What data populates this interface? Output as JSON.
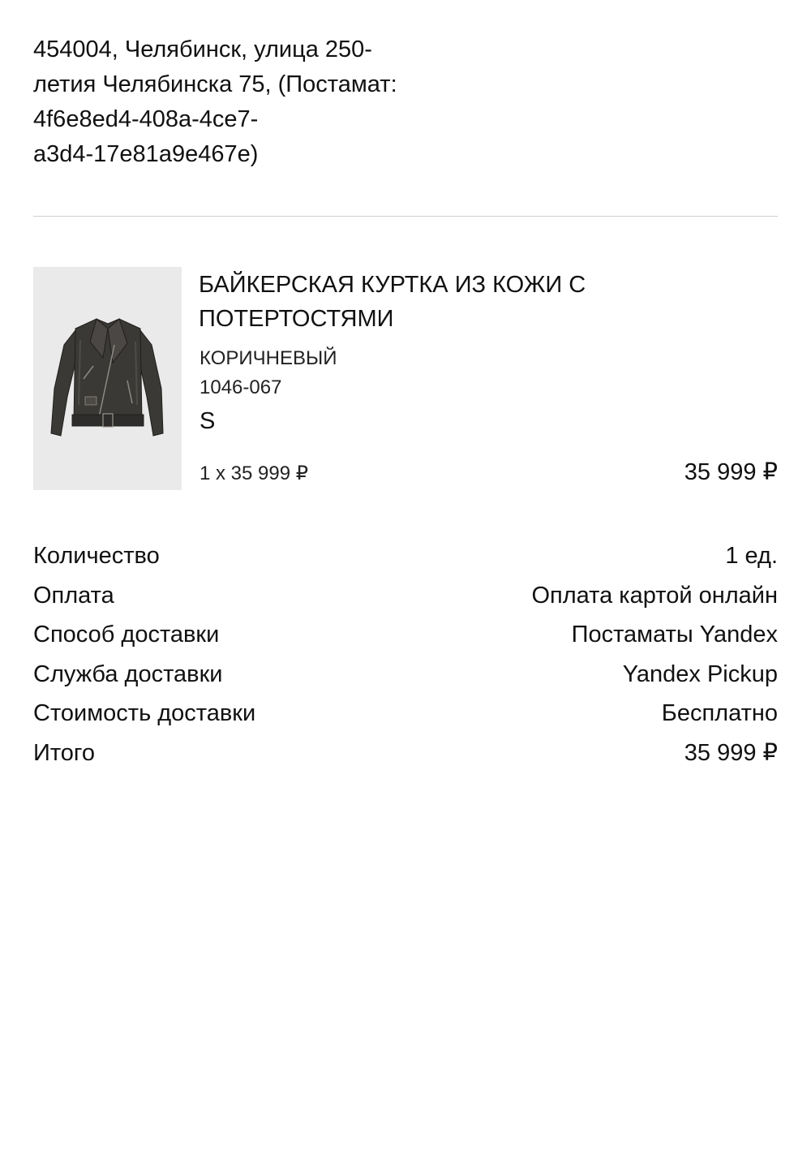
{
  "address": {
    "lines": [
      "454004, Челябинск, улица 250-",
      "летия Челябинска 75, (Постамат:",
      "4f6e8ed4-408a-4ce7-",
      "a3d4-17e81a9e467e)"
    ]
  },
  "product": {
    "image_icon": "leather-biker-jacket",
    "name_lines": [
      "БАЙКЕРСКАЯ КУРТКА ИЗ КОЖИ С",
      "ПОТЕРТОСТЯМИ"
    ],
    "color": "КОРИЧНЕВЫЙ",
    "code": "1046-067",
    "size": "S",
    "qty_price": "1 x 35 999 ₽",
    "total": "35 999 ₽"
  },
  "summary": {
    "rows": [
      {
        "label": "Количество",
        "value": "1 ед."
      },
      {
        "label": "Оплата",
        "value": "Оплата картой онлайн"
      },
      {
        "label": "Способ доставки",
        "value": "Постаматы Yandex"
      },
      {
        "label": "Служба доставки",
        "value": "Yandex Pickup"
      },
      {
        "label": "Стоимость доставки",
        "value": "Бесплатно"
      },
      {
        "label": "Итого",
        "value": "35 999 ₽"
      }
    ]
  }
}
